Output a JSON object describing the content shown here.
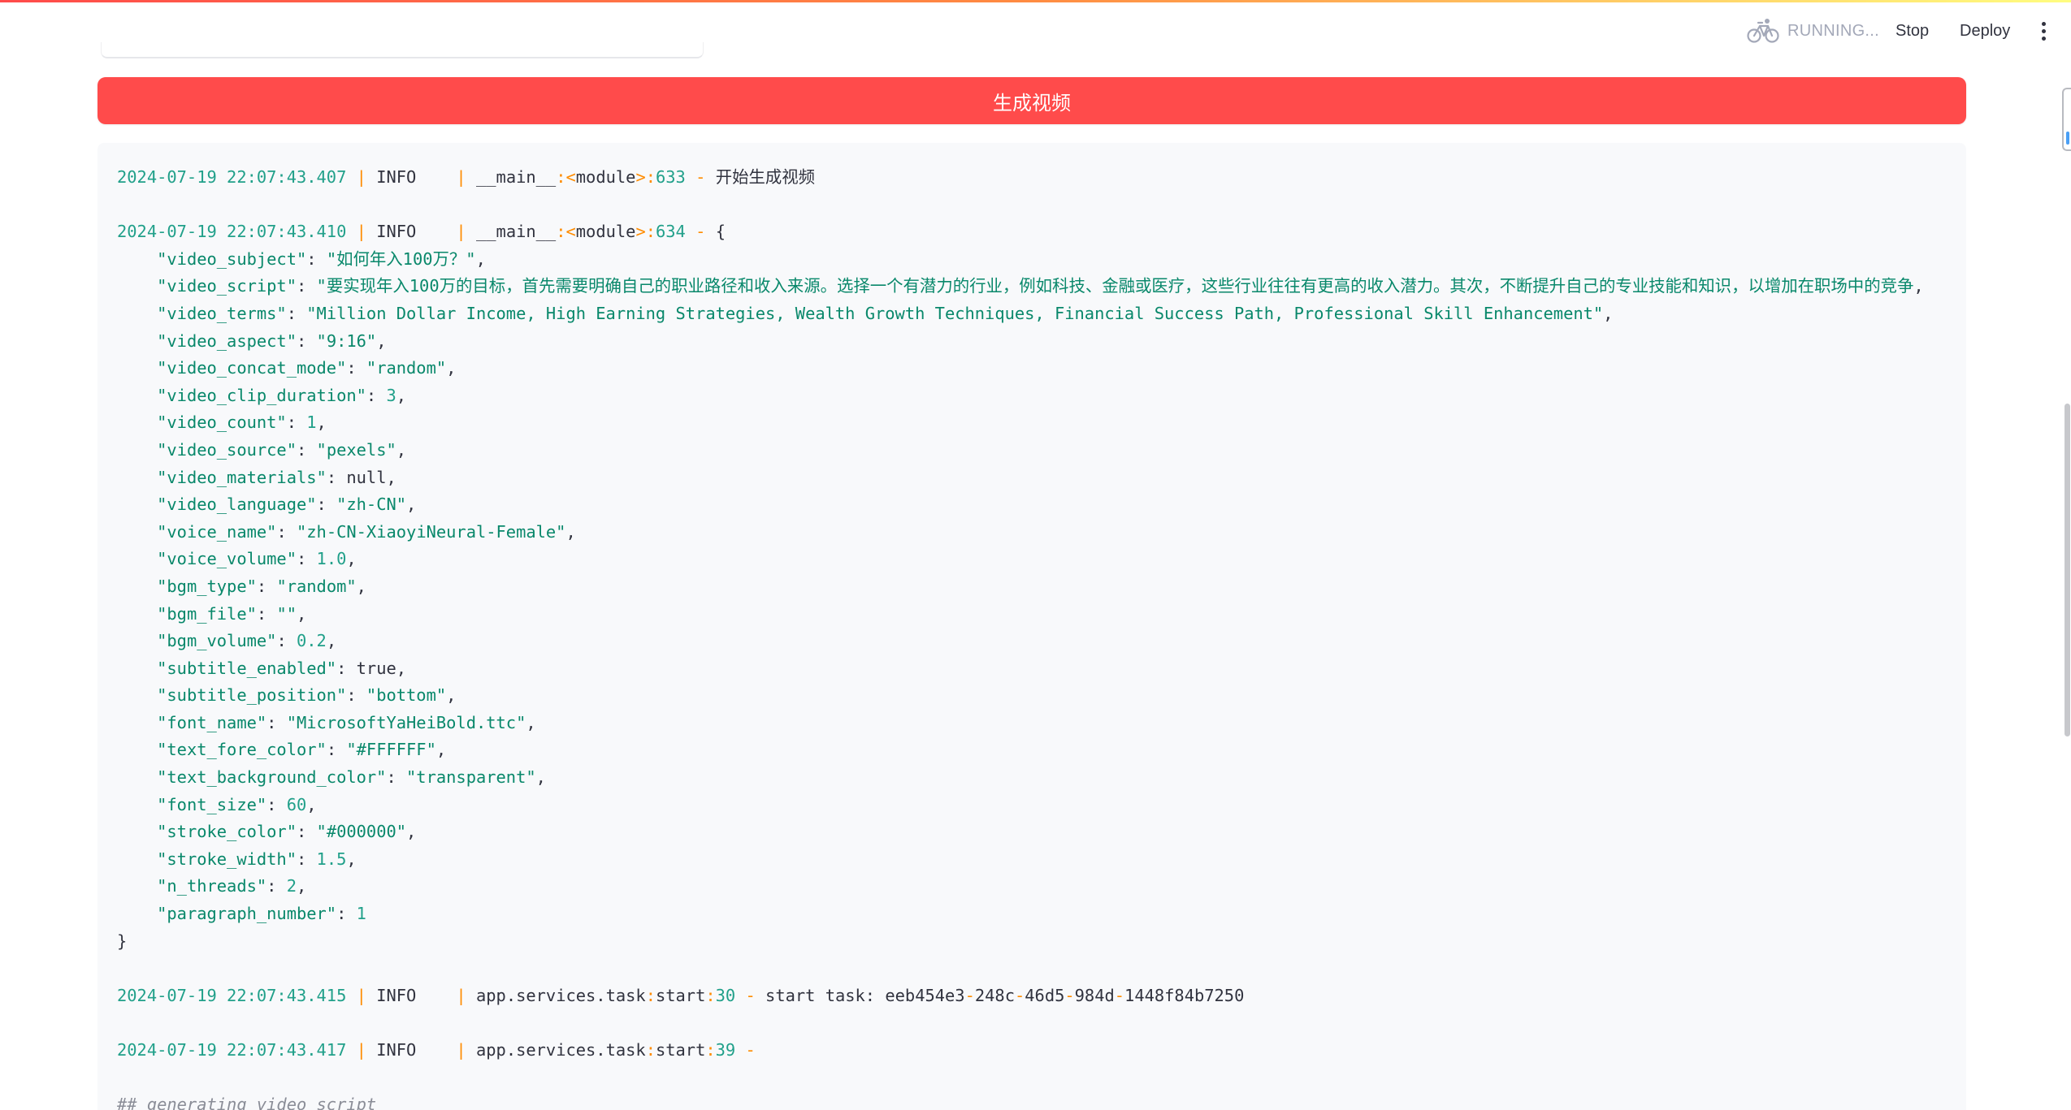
{
  "header": {
    "status_icon": "running-bicycle-icon",
    "status_label": "RUNNING...",
    "stop_label": "Stop",
    "deploy_label": "Deploy",
    "menu_icon": "vertical-ellipsis-icon"
  },
  "generate_button": {
    "label": "生成视频"
  },
  "log": {
    "entries": [
      {
        "timestamp": "2024-07-19 22:07:43.407",
        "level": "INFO",
        "pipe": "|",
        "module": "__main__",
        "location": "<module>",
        "line": "633",
        "dash": "-",
        "message": "开始生成视频"
      },
      {
        "timestamp": "2024-07-19 22:07:43.410",
        "level": "INFO",
        "pipe": "|",
        "module": "__main__",
        "location": "<module>",
        "line": "634",
        "dash": "-",
        "message": "{"
      },
      {
        "timestamp": "2024-07-19 22:07:43.415",
        "level": "INFO",
        "pipe": "|",
        "module": "app.services.task",
        "location": "start",
        "line": "30",
        "dash": "-",
        "message": "start task: eeb454e3-248c-46d5-984d-1448f84b7250"
      },
      {
        "timestamp": "2024-07-19 22:07:43.417",
        "level": "INFO",
        "pipe": "|",
        "module": "app.services.task",
        "location": "start",
        "line": "39",
        "dash": "-",
        "message": ""
      }
    ],
    "params": [
      {
        "key": "\"video_subject\"",
        "value": "\"如何年入100万？\"",
        "type": "string"
      },
      {
        "key": "\"video_script\"",
        "value": "\"要实现年入100万的目标，首先需要明确自己的职业路径和收入来源。选择一个有潜力的行业，例如科技、金融或医疗，这些行业往往有更高的收入潜力。其次，不断提升自己的专业技能和知识，以增加在职场中的竞争",
        "type": "string"
      },
      {
        "key": "\"video_terms\"",
        "value": "\"Million Dollar Income, High Earning Strategies, Wealth Growth Techniques, Financial Success Path, Professional Skill Enhancement\"",
        "type": "string"
      },
      {
        "key": "\"video_aspect\"",
        "value": "\"9:16\"",
        "type": "string"
      },
      {
        "key": "\"video_concat_mode\"",
        "value": "\"random\"",
        "type": "string"
      },
      {
        "key": "\"video_clip_duration\"",
        "value": "3",
        "type": "number"
      },
      {
        "key": "\"video_count\"",
        "value": "1",
        "type": "number"
      },
      {
        "key": "\"video_source\"",
        "value": "\"pexels\"",
        "type": "string"
      },
      {
        "key": "\"video_materials\"",
        "value": "null",
        "type": "keyword"
      },
      {
        "key": "\"video_language\"",
        "value": "\"zh-CN\"",
        "type": "string"
      },
      {
        "key": "\"voice_name\"",
        "value": "\"zh-CN-XiaoyiNeural-Female\"",
        "type": "string"
      },
      {
        "key": "\"voice_volume\"",
        "value": "1.0",
        "type": "number"
      },
      {
        "key": "\"bgm_type\"",
        "value": "\"random\"",
        "type": "string"
      },
      {
        "key": "\"bgm_file\"",
        "value": "\"\"",
        "type": "string"
      },
      {
        "key": "\"bgm_volume\"",
        "value": "0.2",
        "type": "number"
      },
      {
        "key": "\"subtitle_enabled\"",
        "value": "true",
        "type": "keyword"
      },
      {
        "key": "\"subtitle_position\"",
        "value": "\"bottom\"",
        "type": "string"
      },
      {
        "key": "\"font_name\"",
        "value": "\"MicrosoftYaHeiBold.ttc\"",
        "type": "string"
      },
      {
        "key": "\"text_fore_color\"",
        "value": "\"#FFFFFF\"",
        "type": "string"
      },
      {
        "key": "\"text_background_color\"",
        "value": "\"transparent\"",
        "type": "string"
      },
      {
        "key": "\"font_size\"",
        "value": "60",
        "type": "number"
      },
      {
        "key": "\"stroke_color\"",
        "value": "\"#000000\"",
        "type": "string"
      },
      {
        "key": "\"stroke_width\"",
        "value": "1.5",
        "type": "number"
      },
      {
        "key": "\"n_threads\"",
        "value": "2",
        "type": "number"
      },
      {
        "key": "\"paragraph_number\"",
        "value": "1",
        "type": "number"
      }
    ],
    "param_punct": {
      "colon": ":",
      "comma": ","
    },
    "closing_brace": "}",
    "trailing_comment": "## generating video script"
  },
  "colors": {
    "accent": "#ff4b4b",
    "timestamp": "#21a08a",
    "string_value": "#09886b",
    "separator": "#ff8c00",
    "text": "#31333f",
    "log_background": "#f8f9fb"
  }
}
